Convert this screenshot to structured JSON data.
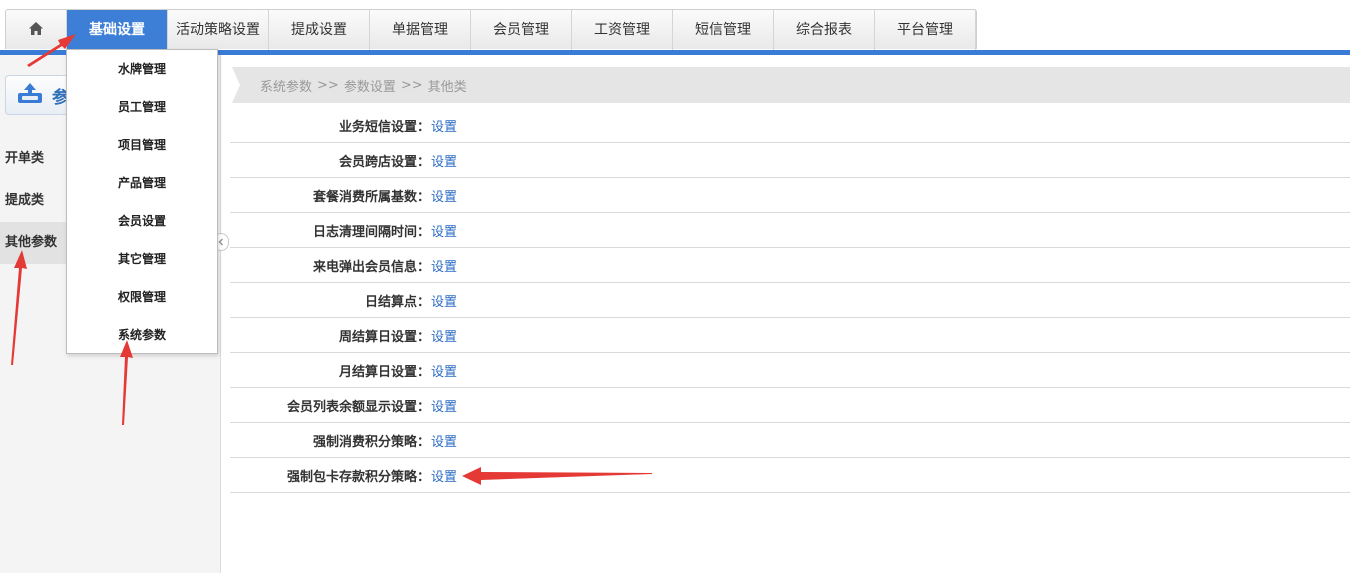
{
  "nav": {
    "home_icon": "home-icon",
    "items": [
      "基础设置",
      "活动策略设置",
      "提成设置",
      "单据管理",
      "会员管理",
      "工资管理",
      "短信管理",
      "综合报表",
      "平台管理"
    ],
    "active_index": 0
  },
  "dropdown": {
    "items": [
      "水牌管理",
      "员工管理",
      "项目管理",
      "产品管理",
      "会员设置",
      "其它管理",
      "权限管理",
      "系统参数"
    ]
  },
  "sidebar": {
    "button_label": "参",
    "button_icon": "parameter-icon",
    "items": [
      "开单类",
      "提成类",
      "其他参数"
    ],
    "selected_index": 2
  },
  "breadcrumb": {
    "parts": [
      "系统参数",
      "参数设置",
      "其他类"
    ],
    "separators": [
      ">>",
      ">>"
    ]
  },
  "settings": {
    "link_text": "设置",
    "rows": [
      "业务短信设置：",
      "会员跨店设置：",
      "套餐消费所属基数：",
      "日志清理间隔时间：",
      "来电弹出会员信息：",
      "日结算点：",
      "周结算日设置：",
      "月结算日设置：",
      "会员列表余额显示设置：",
      "强制消费积分策略：",
      "强制包卡存款积分策略："
    ]
  },
  "colors": {
    "accent_blue": "#3a7bd5",
    "link_blue": "#2b6cc4",
    "annotation_red": "#e53935"
  }
}
